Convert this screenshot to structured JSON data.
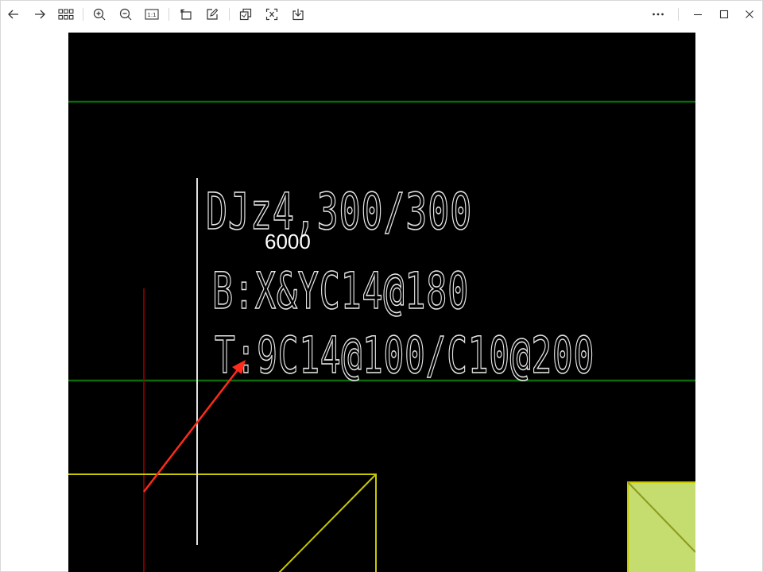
{
  "toolbar": {
    "left_icons": [
      "back-arrow-icon",
      "forward-arrow-icon",
      "thumbnail-grid-icon",
      "zoom-in-icon",
      "zoom-out-icon",
      "actual-size-icon",
      "rotate-icon",
      "edit-icon",
      "crop-icon",
      "text-recognition-icon",
      "save-icon"
    ],
    "actual_size_label": "1:1",
    "right_icons": [
      "more-options-icon",
      "minimize-icon",
      "maximize-icon",
      "close-icon"
    ]
  },
  "drawing": {
    "label_line1": "DJz4,300/300",
    "dimension": "6000",
    "label_line2": "B:X&YC14@180",
    "label_line3": "T:9C14@100/C10@200",
    "colors": {
      "background": "#000000",
      "axis_lines": "#0a6b0a",
      "text": "#e6e6e6",
      "leader_line": "#e0e0e0",
      "column_line": "#a00000",
      "foundation_outline": "#c8c800",
      "foundation_fill": "#c5dc6e",
      "annotation_arrow": "#ff2a1a"
    }
  }
}
